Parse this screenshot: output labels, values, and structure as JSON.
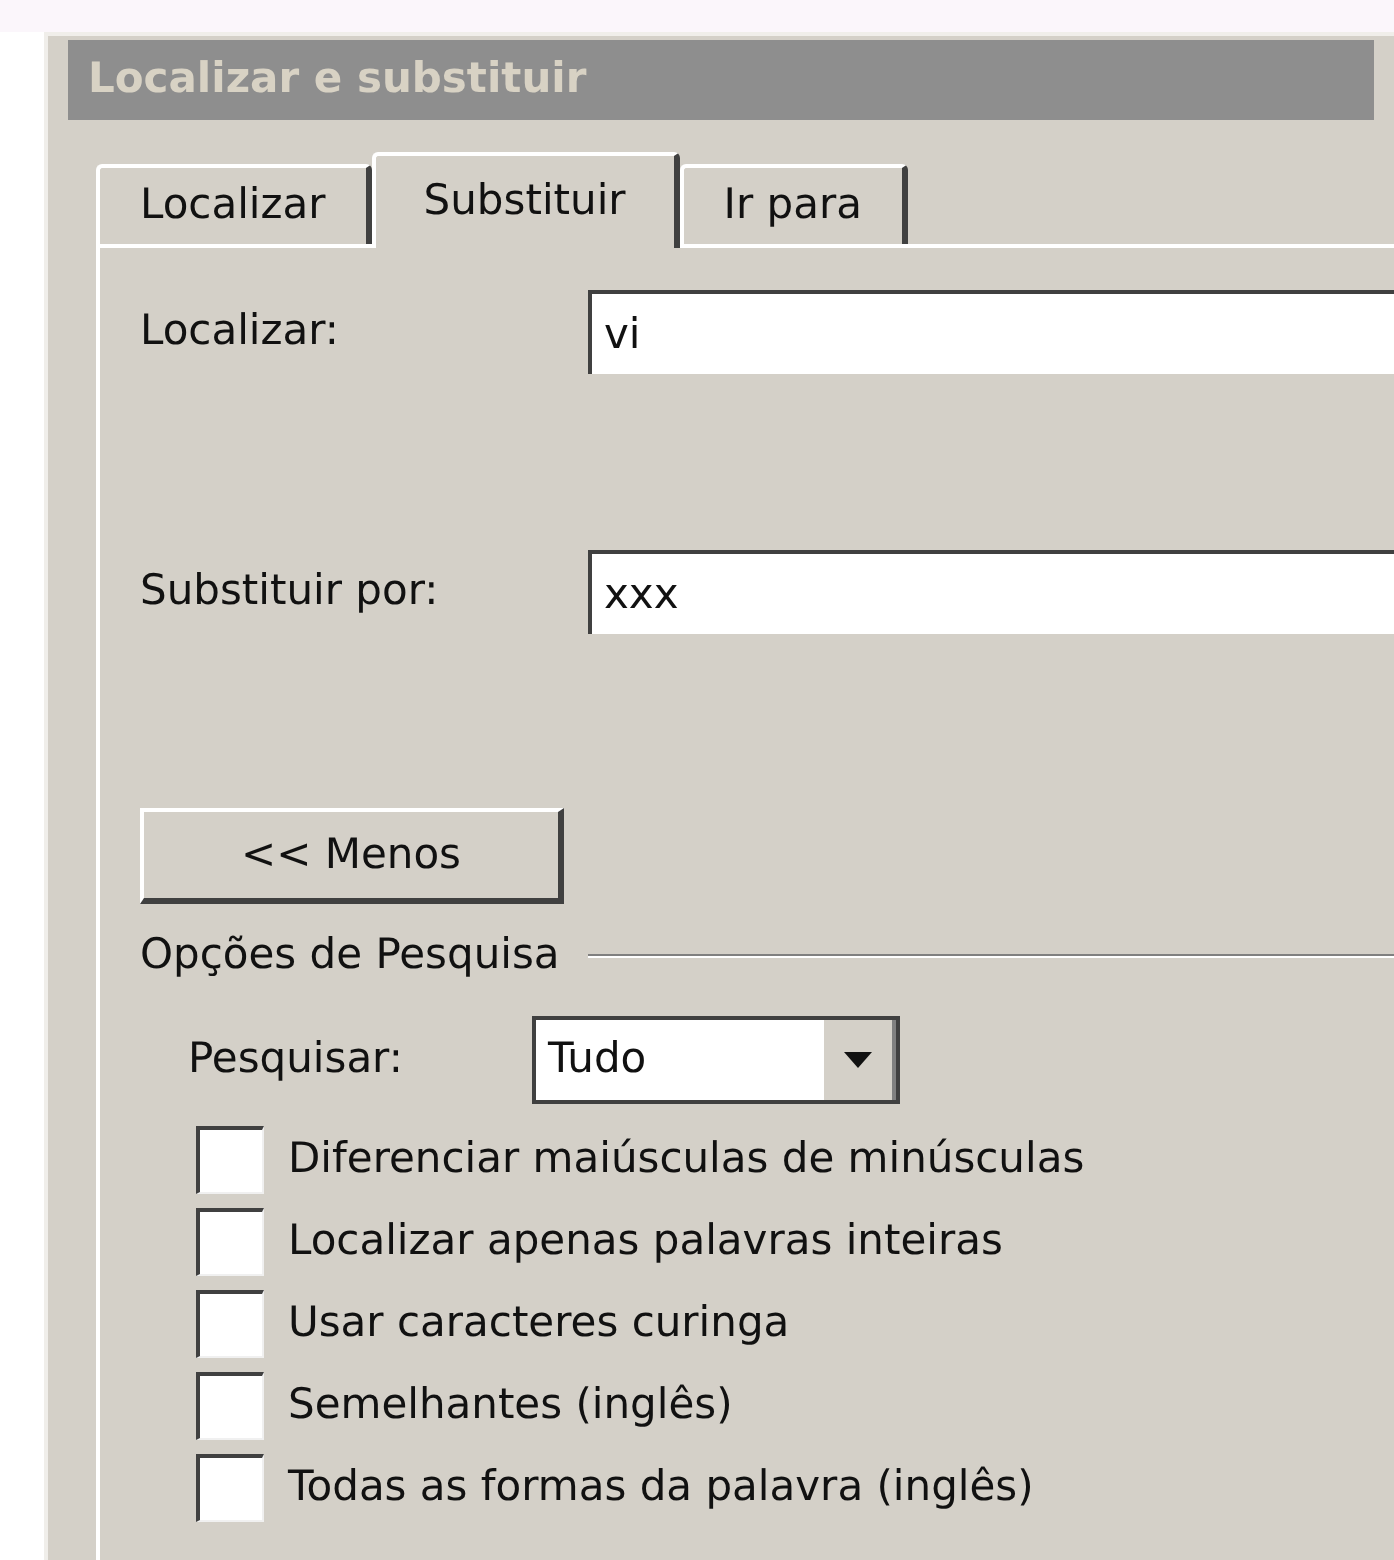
{
  "window": {
    "title": "Localizar e substituir"
  },
  "tabs": [
    {
      "label": "Localizar",
      "selected": false
    },
    {
      "label": "Substituir",
      "selected": true
    },
    {
      "label": "Ir para",
      "selected": false
    }
  ],
  "fields": [
    {
      "label": "Localizar:",
      "value": "vi"
    },
    {
      "label": "Substituir por:",
      "value": "xxx"
    }
  ],
  "less_button": "<< Menos",
  "search_options": {
    "title": "Opções de Pesquisa",
    "search_label": "Pesquisar:",
    "search_value": "Tudo",
    "checkboxes": [
      {
        "label": "Diferenciar maiúsculas de minúsculas",
        "checked": false
      },
      {
        "label": "Localizar apenas palavras inteiras",
        "checked": false
      },
      {
        "label": "Usar caracteres curinga",
        "checked": false
      },
      {
        "label": "Semelhantes (inglês)",
        "checked": false
      },
      {
        "label": "Todas as formas da palavra (inglês)",
        "checked": false
      }
    ]
  }
}
